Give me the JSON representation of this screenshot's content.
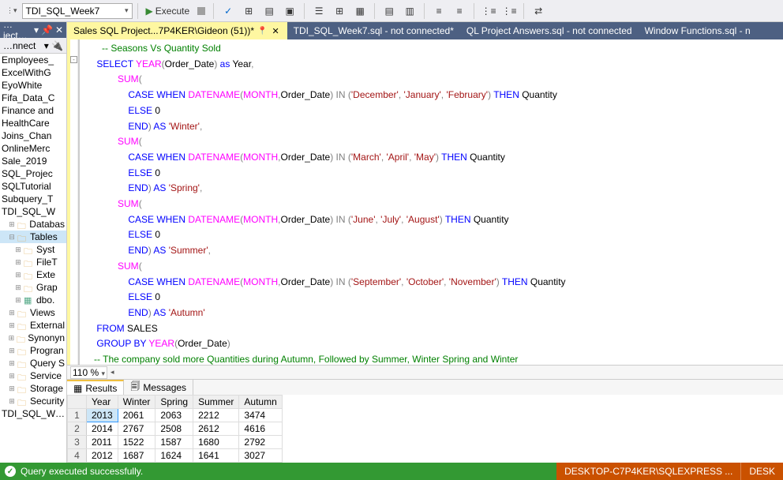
{
  "toolbar": {
    "database": "TDI_SQL_Week7",
    "execute": "Execute"
  },
  "sidebar": {
    "title": "…ject…",
    "connect": "…nnect",
    "items": [
      {
        "label": "Employees_",
        "indent": 0,
        "folder": false
      },
      {
        "label": "ExcelWithG",
        "indent": 0,
        "folder": false
      },
      {
        "label": "EyoWhite",
        "indent": 0,
        "folder": false
      },
      {
        "label": "Fifa_Data_C",
        "indent": 0,
        "folder": false
      },
      {
        "label": "Finance and",
        "indent": 0,
        "folder": false
      },
      {
        "label": "HealthCare",
        "indent": 0,
        "folder": false
      },
      {
        "label": "Joins_Chan",
        "indent": 0,
        "folder": false
      },
      {
        "label": "OnlineMerc",
        "indent": 0,
        "folder": false
      },
      {
        "label": "Sale_2019",
        "indent": 0,
        "folder": false
      },
      {
        "label": "SQL_Projec",
        "indent": 0,
        "folder": false
      },
      {
        "label": "SQLTutorial",
        "indent": 0,
        "folder": false
      },
      {
        "label": "Subquery_T",
        "indent": 0,
        "folder": false
      },
      {
        "label": "TDI_SQL_W",
        "indent": 0,
        "folder": false
      },
      {
        "label": "Databas",
        "indent": 1,
        "folder": true,
        "exp": "+"
      },
      {
        "label": "Tables",
        "indent": 1,
        "folder": true,
        "exp": "-",
        "sel": true
      },
      {
        "label": "Syst",
        "indent": 2,
        "folder": true,
        "exp": "+"
      },
      {
        "label": "FileT",
        "indent": 2,
        "folder": true,
        "exp": "+"
      },
      {
        "label": "Exte",
        "indent": 2,
        "folder": true,
        "exp": "+"
      },
      {
        "label": "Grap",
        "indent": 2,
        "folder": true,
        "exp": "+"
      },
      {
        "label": "dbo.",
        "indent": 2,
        "folder": false,
        "exp": "+",
        "table": true
      },
      {
        "label": "Views",
        "indent": 1,
        "folder": true,
        "exp": "+"
      },
      {
        "label": "External",
        "indent": 1,
        "folder": true,
        "exp": "+"
      },
      {
        "label": "Synonyn",
        "indent": 1,
        "folder": true,
        "exp": "+"
      },
      {
        "label": "Progran",
        "indent": 1,
        "folder": true,
        "exp": "+"
      },
      {
        "label": "Query S",
        "indent": 1,
        "folder": true,
        "exp": "+"
      },
      {
        "label": "Service",
        "indent": 1,
        "folder": true,
        "exp": "+"
      },
      {
        "label": "Storage",
        "indent": 1,
        "folder": true,
        "exp": "+"
      },
      {
        "label": "Security",
        "indent": 1,
        "folder": true,
        "exp": "+"
      },
      {
        "label": "TDI_SQL_W…",
        "indent": 0,
        "folder": false
      }
    ]
  },
  "tabs": {
    "items": [
      {
        "label": "Sales SQL Project...7P4KER\\Gideon (51))*",
        "active": true,
        "pinned": true,
        "closable": true
      },
      {
        "label": "TDI_SQL_Week7.sql - not connected*",
        "active": false
      },
      {
        "label": "QL Project Answers.sql - not connected",
        "active": false
      },
      {
        "label": "Window Functions.sql - n",
        "active": false
      }
    ]
  },
  "zoom": {
    "value": "110 %"
  },
  "results": {
    "tabs": {
      "results": "Results",
      "messages": "Messages"
    },
    "columns": [
      "",
      "Year",
      "Winter",
      "Spring",
      "Summer",
      "Autumn"
    ],
    "chart_data": {
      "type": "table",
      "columns": [
        "Year",
        "Winter",
        "Spring",
        "Summer",
        "Autumn"
      ],
      "rows": [
        [
          2013,
          2061,
          2063,
          2212,
          3474
        ],
        [
          2014,
          2767,
          2508,
          2612,
          4616
        ],
        [
          2011,
          1522,
          1587,
          1680,
          2792
        ],
        [
          2012,
          1687,
          1624,
          1641,
          3027
        ]
      ]
    }
  },
  "status": {
    "message": "Query executed successfully.",
    "server": "DESKTOP-C7P4KER\\SQLEXPRESS ...",
    "user": "DESK"
  },
  "sql": {
    "l1": "      -- Seasons Vs Quantity Sold",
    "l2a": "    ",
    "l2b": "SELECT ",
    "l2c": "YEAR",
    "l2d": "(",
    "l2e": "Order_Date",
    "l2f": ") ",
    "l2g": "as ",
    "l2h": "Year",
    "l2i": ",",
    "l3a": "            ",
    "l3b": "SUM",
    "l3c": "(",
    "l4a": "                ",
    "l4b": "CASE ",
    "l4c": "WHEN ",
    "l4d": "DATENAME",
    "l4e": "(",
    "l4f": "MONTH",
    "l4g": ",",
    "l4h": "Order_Date",
    "l4i": ") ",
    "l4j": "IN ",
    "l4k": "(",
    "l4l": "'December'",
    "l4m": ", ",
    "l4n": "'January'",
    "l4o": ", ",
    "l4p": "'February'",
    "l4q": ") ",
    "l4r": "THEN ",
    "l4s": "Quantity",
    "l5a": "                ",
    "l5b": "ELSE ",
    "l5c": "0",
    "l6a": "                ",
    "l6b": "END",
    "l6c": ") ",
    "l6d": "AS ",
    "l6e": "'Winter'",
    "l6f": ",",
    "l7a": "            ",
    "l7b": "SUM",
    "l7c": "(",
    "l8a": "                ",
    "l8b": "CASE ",
    "l8c": "WHEN ",
    "l8d": "DATENAME",
    "l8e": "(",
    "l8f": "MONTH",
    "l8g": ",",
    "l8h": "Order_Date",
    "l8i": ") ",
    "l8j": "IN ",
    "l8k": "(",
    "l8l": "'March'",
    "l8m": ", ",
    "l8n": "'April'",
    "l8o": ", ",
    "l8p": "'May'",
    "l8q": ") ",
    "l8r": "THEN ",
    "l8s": "Quantity",
    "l9a": "                ",
    "l9b": "ELSE ",
    "l9c": "0",
    "l10a": "                ",
    "l10b": "END",
    "l10c": ") ",
    "l10d": "AS ",
    "l10e": "'Spring'",
    "l10f": ",",
    "l11a": "            ",
    "l11b": "SUM",
    "l11c": "(",
    "l12a": "                ",
    "l12b": "CASE ",
    "l12c": "WHEN ",
    "l12d": "DATENAME",
    "l12e": "(",
    "l12f": "MONTH",
    "l12g": ",",
    "l12h": "Order_Date",
    "l12i": ") ",
    "l12j": "IN ",
    "l12k": "(",
    "l12l": "'June'",
    "l12m": ", ",
    "l12n": "'July'",
    "l12o": ", ",
    "l12p": "'August'",
    "l12q": ") ",
    "l12r": "THEN ",
    "l12s": "Quantity",
    "l13a": "                ",
    "l13b": "ELSE ",
    "l13c": "0",
    "l14a": "                ",
    "l14b": "END",
    "l14c": ") ",
    "l14d": "AS ",
    "l14e": "'Summer'",
    "l14f": ",",
    "l15a": "            ",
    "l15b": "SUM",
    "l15c": "(",
    "l16a": "                ",
    "l16b": "CASE ",
    "l16c": "WHEN ",
    "l16d": "DATENAME",
    "l16e": "(",
    "l16f": "MONTH",
    "l16g": ",",
    "l16h": "Order_Date",
    "l16i": ") ",
    "l16j": "IN ",
    "l16k": "(",
    "l16l": "'September'",
    "l16m": ", ",
    "l16n": "'October'",
    "l16o": ", ",
    "l16p": "'November'",
    "l16q": ") ",
    "l16r": "THEN ",
    "l16s": "Quantity",
    "l17a": "                ",
    "l17b": "ELSE ",
    "l17c": "0",
    "l18a": "                ",
    "l18b": "END",
    "l18c": ") ",
    "l18d": "AS ",
    "l18e": "'Autumn'",
    "l19a": "    ",
    "l19b": "FROM ",
    "l19c": "SALES",
    "l20a": "    ",
    "l20b": "GROUP BY ",
    "l20c": "YEAR",
    "l20d": "(",
    "l20e": "Order_Date",
    "l20f": ")",
    "l21a": "   ",
    "l21b": "-- The company sold more Quantities during Autumn, Followed by Summer, Winter Spring and Winter"
  }
}
